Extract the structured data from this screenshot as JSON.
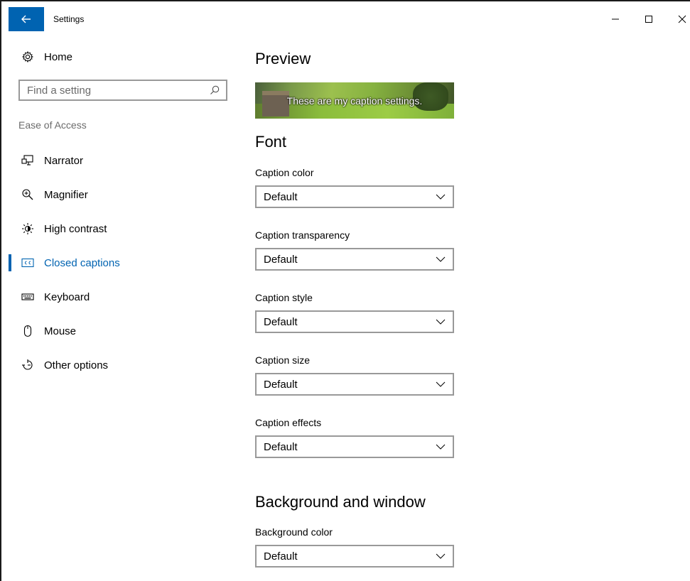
{
  "window": {
    "title": "Settings"
  },
  "sidebar": {
    "home_label": "Home",
    "search_placeholder": "Find a setting",
    "section_label": "Ease of Access",
    "items": [
      {
        "label": "Narrator",
        "icon": "narrator-icon"
      },
      {
        "label": "Magnifier",
        "icon": "magnifier-icon"
      },
      {
        "label": "High contrast",
        "icon": "high-contrast-icon"
      },
      {
        "label": "Closed captions",
        "icon": "closed-captions-icon",
        "selected": true
      },
      {
        "label": "Keyboard",
        "icon": "keyboard-icon"
      },
      {
        "label": "Mouse",
        "icon": "mouse-icon"
      },
      {
        "label": "Other options",
        "icon": "other-options-icon"
      }
    ]
  },
  "main": {
    "preview_heading": "Preview",
    "preview_caption": "These are my caption settings.",
    "font_heading": "Font",
    "font_fields": [
      {
        "label": "Caption color",
        "value": "Default"
      },
      {
        "label": "Caption transparency",
        "value": "Default"
      },
      {
        "label": "Caption style",
        "value": "Default"
      },
      {
        "label": "Caption size",
        "value": "Default"
      },
      {
        "label": "Caption effects",
        "value": "Default"
      }
    ],
    "background_heading": "Background and window",
    "background_fields": [
      {
        "label": "Background color",
        "value": "Default"
      }
    ]
  },
  "colors": {
    "accent": "#0063b1",
    "secondary_text": "#6b6b6b",
    "control_border": "#999999"
  }
}
